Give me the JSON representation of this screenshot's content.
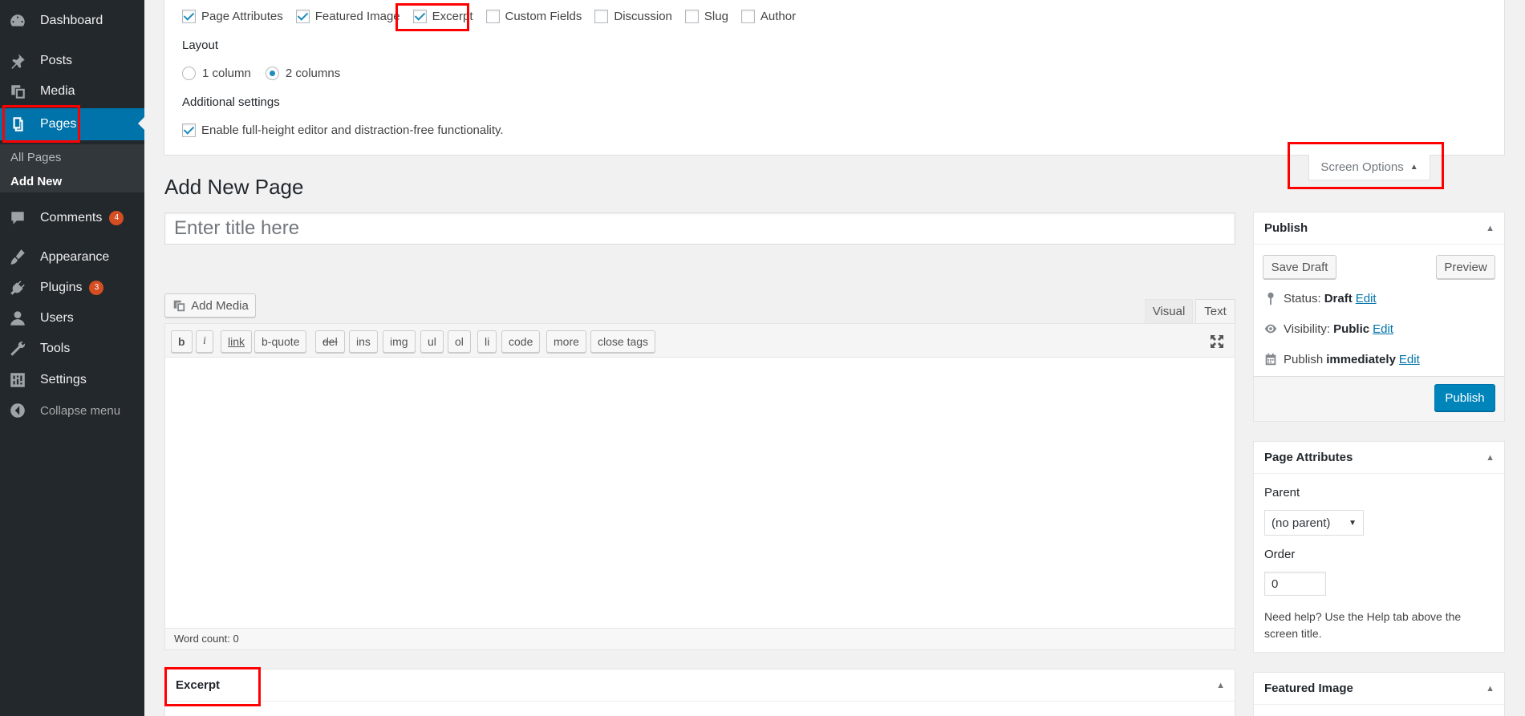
{
  "sidebar": {
    "items": [
      {
        "label": "Dashboard",
        "icon": "dashboard-icon"
      },
      {
        "label": "Posts",
        "icon": "pin-icon"
      },
      {
        "label": "Media",
        "icon": "media-icon"
      },
      {
        "label": "Pages",
        "icon": "pages-icon"
      },
      {
        "label": "Comments",
        "icon": "comment-icon",
        "badge": "4"
      },
      {
        "label": "Appearance",
        "icon": "brush-icon"
      },
      {
        "label": "Plugins",
        "icon": "plugin-icon",
        "badge": "3"
      },
      {
        "label": "Users",
        "icon": "user-icon"
      },
      {
        "label": "Tools",
        "icon": "wrench-icon"
      },
      {
        "label": "Settings",
        "icon": "settings-icon"
      },
      {
        "label": "Collapse menu",
        "icon": "collapse-icon"
      }
    ],
    "submenu": [
      "All Pages",
      "Add New"
    ]
  },
  "screen_options": {
    "boxes": [
      {
        "label": "Page Attributes",
        "checked": true
      },
      {
        "label": "Featured Image",
        "checked": true
      },
      {
        "label": "Excerpt",
        "checked": true
      },
      {
        "label": "Custom Fields",
        "checked": false
      },
      {
        "label": "Discussion",
        "checked": false
      },
      {
        "label": "Slug",
        "checked": false
      },
      {
        "label": "Author",
        "checked": false
      }
    ],
    "layout_label": "Layout",
    "layout_options": [
      "1 column",
      "2 columns"
    ],
    "additional_label": "Additional settings",
    "additional_option": "Enable full-height editor and distraction-free functionality.",
    "tab_label": "Screen Options"
  },
  "editor": {
    "page_title": "Add New Page",
    "title_placeholder": "Enter title here",
    "add_media": "Add Media",
    "tab_visual": "Visual",
    "tab_text": "Text",
    "quicktags": [
      "b",
      "i",
      "link",
      "b-quote",
      "del",
      "ins",
      "img",
      "ul",
      "ol",
      "li",
      "code",
      "more",
      "close tags"
    ],
    "word_count": "Word count: 0"
  },
  "excerpt": {
    "title": "Excerpt"
  },
  "publish": {
    "title": "Publish",
    "save_draft": "Save Draft",
    "preview": "Preview",
    "status_label": "Status:",
    "status_value": "Draft",
    "visibility_label": "Visibility:",
    "visibility_value": "Public",
    "publish_label": "Publish",
    "publish_value": "immediately",
    "edit": "Edit",
    "publish_button": "Publish"
  },
  "attributes": {
    "title": "Page Attributes",
    "parent_label": "Parent",
    "parent_value": "(no parent)",
    "order_label": "Order",
    "order_value": "0",
    "help": "Need help? Use the Help tab above the screen title."
  },
  "featured": {
    "title": "Featured Image"
  },
  "colors": {
    "accent": "#0073aa",
    "sidebar": "#23282d",
    "highlight": "#ff0000",
    "badge": "#d54e21"
  }
}
